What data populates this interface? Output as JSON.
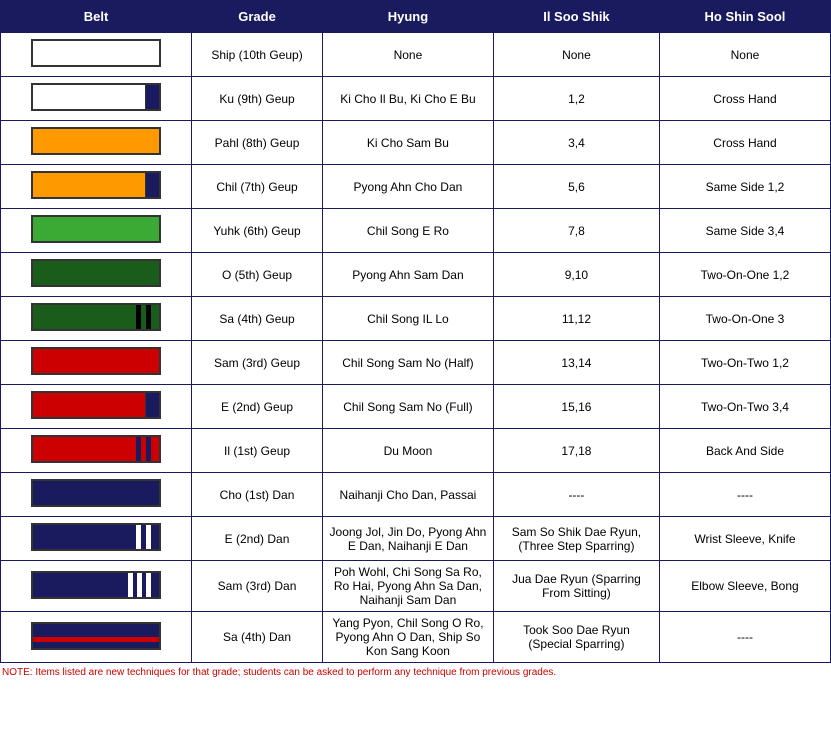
{
  "headers": {
    "belt": "Belt",
    "grade": "Grade",
    "hyung": "Hyung",
    "il_soo_shik": "Il Soo Shik",
    "ho_shin_sool": "Ho Shin Sool"
  },
  "rows": [
    {
      "belt_type": "white",
      "grade": "Ship (10th Geup)",
      "hyung": "None",
      "il_soo_shik": "None",
      "ho_shin_sool": "None"
    },
    {
      "belt_type": "white-tip",
      "grade": "Ku (9th) Geup",
      "hyung": "Ki Cho Il Bu, Ki Cho E Bu",
      "il_soo_shik": "1,2",
      "ho_shin_sool": "Cross Hand"
    },
    {
      "belt_type": "orange",
      "grade": "Pahl (8th) Geup",
      "hyung": "Ki Cho Sam Bu",
      "il_soo_shik": "3,4",
      "ho_shin_sool": "Cross Hand"
    },
    {
      "belt_type": "orange-tip",
      "grade": "Chil (7th) Geup",
      "hyung": "Pyong Ahn Cho Dan",
      "il_soo_shik": "5,6",
      "ho_shin_sool": "Same Side 1,2"
    },
    {
      "belt_type": "green-light",
      "grade": "Yuhk (6th) Geup",
      "hyung": "Chil Song E Ro",
      "il_soo_shik": "7,8",
      "ho_shin_sool": "Same Side 3,4"
    },
    {
      "belt_type": "green-dark",
      "grade": "O (5th) Geup",
      "hyung": "Pyong Ahn Sam Dan",
      "il_soo_shik": "9,10",
      "ho_shin_sool": "Two-On-One 1,2"
    },
    {
      "belt_type": "green-dark-double",
      "grade": "Sa (4th) Geup",
      "hyung": "Chil Song IL Lo",
      "il_soo_shik": "11,12",
      "ho_shin_sool": "Two-On-One 3"
    },
    {
      "belt_type": "red",
      "grade": "Sam (3rd) Geup",
      "hyung": "Chil Song Sam No (Half)",
      "il_soo_shik": "13,14",
      "ho_shin_sool": "Two-On-Two 1,2"
    },
    {
      "belt_type": "red-tip",
      "grade": "E (2nd) Geup",
      "hyung": "Chil Song Sam No (Full)",
      "il_soo_shik": "15,16",
      "ho_shin_sool": "Two-On-Two 3,4"
    },
    {
      "belt_type": "red-double",
      "grade": "Il (1st) Geup",
      "hyung": "Du Moon",
      "il_soo_shik": "17,18",
      "ho_shin_sool": "Back And Side"
    },
    {
      "belt_type": "navy",
      "grade": "Cho (1st) Dan",
      "hyung": "Naihanji Cho Dan, Passai",
      "il_soo_shik": "----",
      "ho_shin_sool": "----"
    },
    {
      "belt_type": "navy-double",
      "grade": "E (2nd) Dan",
      "hyung": "Joong Jol, Jin Do, Pyong Ahn E Dan, Naihanji E Dan",
      "il_soo_shik": "Sam So Shik Dae Ryun, (Three Step Sparring)",
      "ho_shin_sool": "Wrist Sleeve, Knife"
    },
    {
      "belt_type": "navy-triple",
      "grade": "Sam (3rd) Dan",
      "hyung": "Poh Wohl, Chi Song Sa Ro, Ro Hai, Pyong Ahn Sa Dan, Naihanji Sam Dan",
      "il_soo_shik": "Jua Dae Ryun (Sparring From Sitting)",
      "ho_shin_sool": "Elbow Sleeve, Bong"
    },
    {
      "belt_type": "navy-red",
      "grade": "Sa (4th) Dan",
      "hyung": "Yang Pyon, Chil Song O Ro, Pyong Ahn O Dan, Ship So Kon Sang Koon",
      "il_soo_shik": "Took Soo Dae Ryun (Special Sparring)",
      "ho_shin_sool": "----"
    }
  ],
  "note": "NOTE: Items listed are new techniques for that grade; students can be asked to perform any technique from previous grades."
}
